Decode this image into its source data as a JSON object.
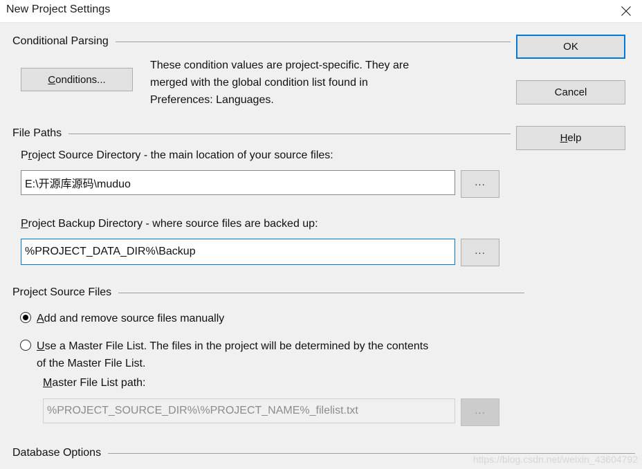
{
  "window": {
    "title": "New Project Settings",
    "close_icon": "close-icon"
  },
  "buttons": {
    "ok": "OK",
    "cancel": "Cancel",
    "help_prefix": "",
    "help_accel": "H",
    "help_suffix": "elp"
  },
  "conditional_parsing": {
    "group_title": "Conditional Parsing",
    "conditions_accel": "C",
    "conditions_suffix": "onditions...",
    "description_line1": "These condition values are project-specific.  They are",
    "description_line2": "merged with the global condition list found in",
    "description_line3": "Preferences: Languages."
  },
  "file_paths": {
    "group_title": "File Paths",
    "source_label_prefix": "P",
    "source_label_accel": "r",
    "source_label_suffix": "oject Source Directory - the main location of your source files:",
    "source_value": "E:\\开源库源码\\muduo",
    "source_browse": "...",
    "backup_label_accel": "P",
    "backup_label_suffix": "roject Backup Directory - where source files are backed up:",
    "backup_value": "%PROJECT_DATA_DIR%\\Backup",
    "backup_browse": "..."
  },
  "project_source_files": {
    "group_title": "Project Source Files",
    "option_manual_accel": "A",
    "option_manual_suffix": "dd and remove source files manually",
    "option_manual_selected": true,
    "option_masterlist_accel": "U",
    "option_masterlist_line1_suffix": "se a Master File List. The files in the project will be determined by the contents",
    "option_masterlist_line2": "of the Master File List.",
    "option_masterlist_selected": false,
    "masterlist_path_accel": "M",
    "masterlist_path_label_suffix": "aster File List path:",
    "masterlist_path_value": "%PROJECT_SOURCE_DIR%\\%PROJECT_NAME%_filelist.txt",
    "masterlist_browse": "...",
    "masterlist_disabled": true
  },
  "database_options": {
    "group_title": "Database Options"
  },
  "watermark": "https://blog.csdn.net/weixin_43604792",
  "colors": {
    "dialog_bg": "#f0f0f0",
    "titlebar_bg": "#ffffff",
    "accent_focus": "#0078d7",
    "button_face": "#e1e1e1",
    "button_border": "#adadad",
    "group_line": "#a0a0a0",
    "text": "#111111",
    "disabled_text": "#8c8c8c"
  }
}
